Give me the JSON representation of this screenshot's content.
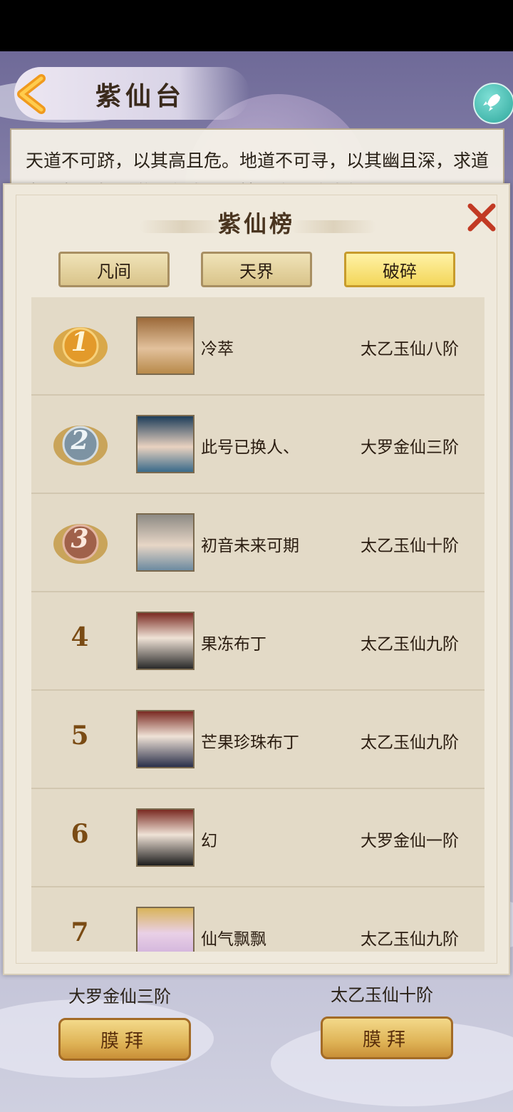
{
  "header": {
    "title": "紫仙台"
  },
  "intro": {
    "text": "天道不可跻，以其高且危。地道不可寻，以其幽且深，求道者无数，如果道业有成，汲榜耀之，焰惠气"
  },
  "bottom": {
    "left_realm": "大罗金仙三阶",
    "right_realm": "太乙玉仙十阶",
    "left_button": "膜拜",
    "right_button": "膜拜"
  },
  "modal": {
    "title": "紫仙榜",
    "tabs": [
      {
        "label": "凡间",
        "active": false
      },
      {
        "label": "天界",
        "active": false
      },
      {
        "label": "破碎",
        "active": true
      }
    ],
    "rows": [
      {
        "rank": "1",
        "name": "冷萃",
        "realm": "太乙玉仙八阶"
      },
      {
        "rank": "2",
        "name": "此号已换人、",
        "realm": "大罗金仙三阶"
      },
      {
        "rank": "3",
        "name": "初音未来可期",
        "realm": "太乙玉仙十阶"
      },
      {
        "rank": "4",
        "name": "果冻布丁",
        "realm": "太乙玉仙九阶"
      },
      {
        "rank": "5",
        "name": "芒果珍珠布丁",
        "realm": "太乙玉仙九阶"
      },
      {
        "rank": "6",
        "name": "幻",
        "realm": "大罗金仙一阶"
      },
      {
        "rank": "7",
        "name": "仙气飘飘",
        "realm": "太乙玉仙九阶"
      }
    ]
  },
  "colors": {
    "medal_gold": "#e39a2a",
    "medal_silver": "#7d93a3",
    "medal_bronze": "#a0614a",
    "close": "#c23a24"
  },
  "icons": {
    "back": "chevron-left-icon",
    "rocket": "rocket-icon",
    "close": "close-icon"
  }
}
